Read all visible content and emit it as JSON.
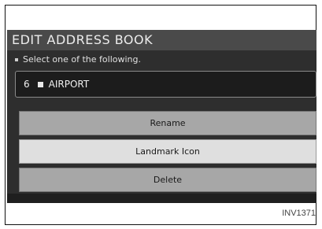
{
  "screen": {
    "title": "EDIT ADDRESS BOOK",
    "instruction": "Select one of the following.",
    "entry": {
      "number": "6",
      "name": "AIRPORT"
    },
    "options": [
      {
        "label": "Rename",
        "selected": false
      },
      {
        "label": "Landmark Icon",
        "selected": true
      },
      {
        "label": "Delete",
        "selected": false
      }
    ]
  },
  "figure_code": "INV1371"
}
